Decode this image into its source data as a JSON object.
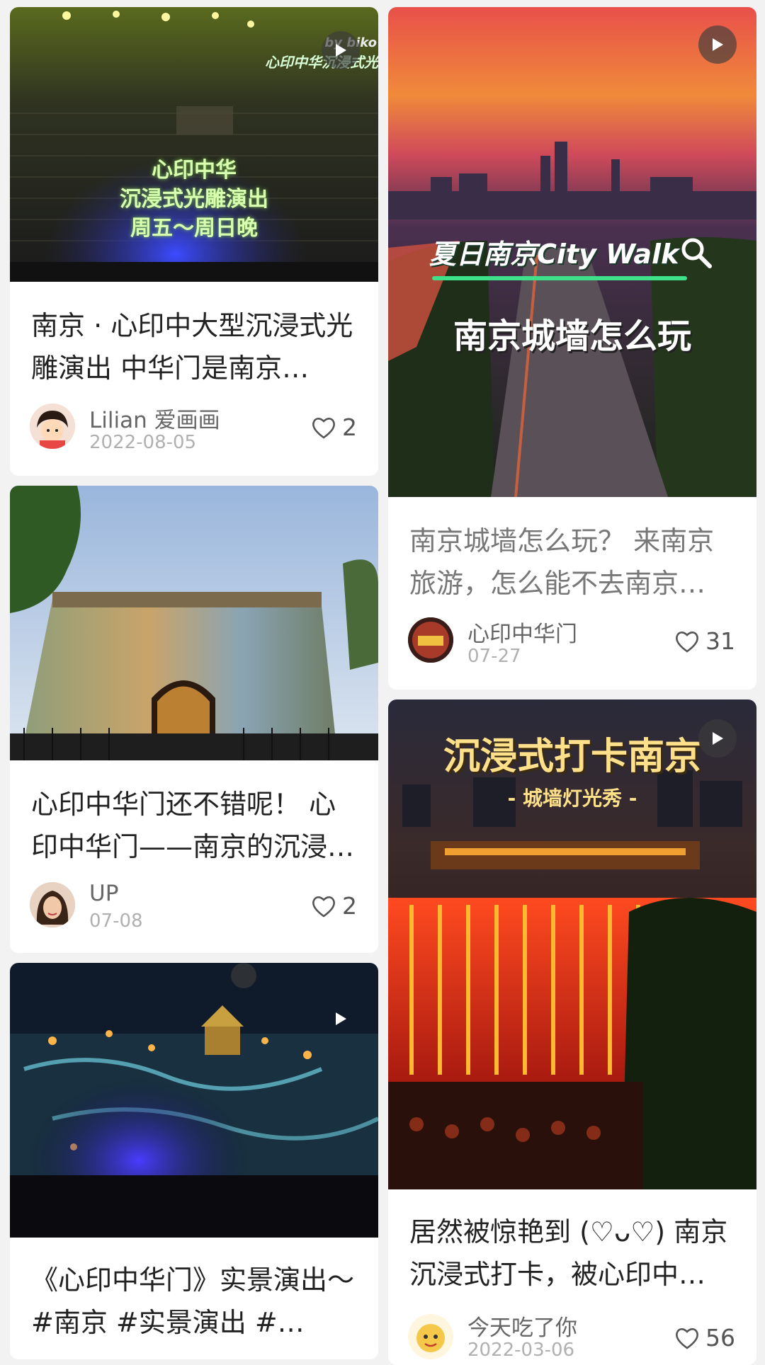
{
  "feed": [
    {
      "title": "南京 · 心印中大型沉浸式光雕演出 中华门是南京…",
      "author": "Lilian 爱画画",
      "date": "2022-08-05",
      "likes": "2",
      "image_caption_lines": [
        "心印中华",
        "沉浸式光雕演出",
        "周五～周日晚"
      ],
      "image_watermark": "心印中华沉浸式光",
      "image_watermark2": "by biko",
      "icon": "play-icon"
    },
    {
      "title": "南京城墙怎么玩？ 来南京旅游，怎么能不去南京…",
      "author": "心印中华门",
      "date": "07-27",
      "likes": "31",
      "image_caption_top": "夏日南京City Walk",
      "image_caption_main": "南京城墙怎么玩",
      "icon": "play-icon"
    },
    {
      "title": "心印中华门还不错呢！ 心印中华门——南京的沉浸…",
      "author": "UP",
      "date": "07-08",
      "likes": "2"
    },
    {
      "title": "居然被惊艳到 (♡ᴗ♡) 南京沉浸式打卡，被心印中…",
      "author": "今天吃了你",
      "date": "2022-03-06",
      "likes": "56",
      "image_caption_top": "沉浸式打卡南京",
      "image_caption_sub": "- 城墙灯光秀 -",
      "icon": "play-icon"
    },
    {
      "title": "《心印中华门》实景演出～ #南京 #实景演出 #…",
      "icon": "play-icon"
    }
  ],
  "colors": {
    "accent_green": "#3fe08a",
    "like_gray": "#555555"
  },
  "icons": {
    "like": "heart-outline-icon",
    "play": "play-icon"
  }
}
